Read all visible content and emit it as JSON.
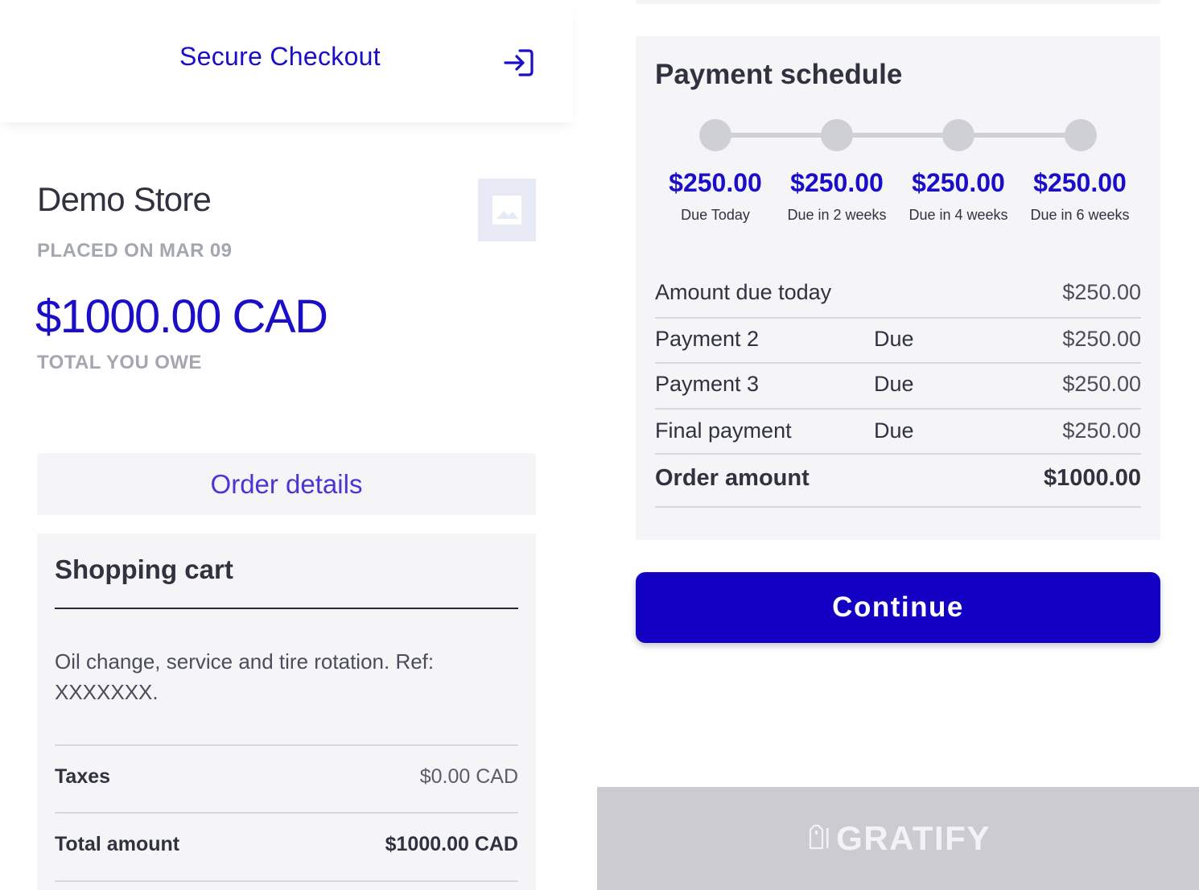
{
  "header": {
    "title": "Secure Checkout",
    "login_icon": "login-arrow-icon"
  },
  "store": {
    "name": "Demo Store",
    "placed_on": "PLACED ON MAR 09",
    "total": "$1000.00 CAD",
    "total_label": "TOTAL YOU OWE",
    "logo_icon": "image-placeholder-icon"
  },
  "order_details": {
    "label": "Order details"
  },
  "cart": {
    "title": "Shopping cart",
    "description": "Oil change, service and tire rotation. Ref: XXXXXXX.",
    "rows": [
      {
        "label": "Taxes",
        "value": "$0.00 CAD"
      },
      {
        "label": "Total amount",
        "value": "$1000.00 CAD"
      }
    ]
  },
  "schedule": {
    "title": "Payment schedule",
    "timeline": [
      {
        "amount": "$250.00",
        "due": "Due Today"
      },
      {
        "amount": "$250.00",
        "due": "Due in 2 weeks"
      },
      {
        "amount": "$250.00",
        "due": "Due in 4 weeks"
      },
      {
        "amount": "$250.00",
        "due": "Due in 6 weeks"
      }
    ],
    "rows": [
      {
        "label": "Amount due today",
        "due": "",
        "value": "$250.00"
      },
      {
        "label": "Payment 2",
        "due": "Due",
        "value": "$250.00"
      },
      {
        "label": "Payment 3",
        "due": "Due",
        "value": "$250.00"
      },
      {
        "label": "Final payment",
        "due": "Due",
        "value": "$250.00"
      },
      {
        "label": "Order amount",
        "due": "",
        "value": "$1000.00"
      }
    ]
  },
  "actions": {
    "continue_label": "Continue"
  },
  "footer": {
    "brand": "GRATIFY",
    "brand_icon": "gratify-tag-icon"
  },
  "colors": {
    "accent": "#1a0fc7",
    "button": "#1300c3",
    "card_bg": "#f5f5f8",
    "muted": "#a4a6b0",
    "footer_bg": "#cbcbd1"
  }
}
